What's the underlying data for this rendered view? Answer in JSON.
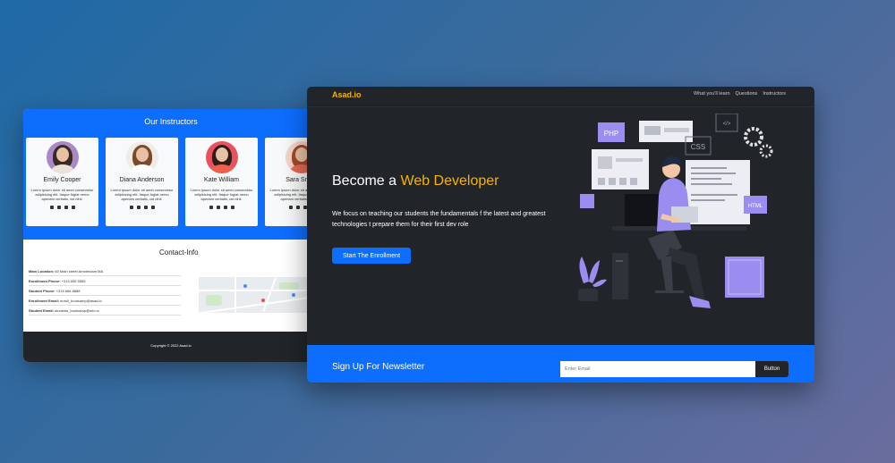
{
  "back_window": {
    "instructors": {
      "title": "Our Instructors",
      "people": [
        {
          "name": "Emily Cooper",
          "bio": "Lorem ipsum dolor sit amet consectetur adipisicing elit. Itaque fugiat nemo aperiam veritatis, cst nihil.",
          "bg": "#a98ac7",
          "hair": "#3b2a23",
          "shirt": "#e8e2d9"
        },
        {
          "name": "Diana Anderson",
          "bio": "Lorem ipsum dolor sit amet consectetur adipisicing elit. Itaque fugiat nemo aperiam veritatis, cst nihil.",
          "bg": "#f1ece6",
          "hair": "#7a4a2c",
          "shirt": "#ffffff"
        },
        {
          "name": "Kate William",
          "bio": "Lorem ipsum dolor sit amet consectetur adipisicing elit. Itaque fugiat nemo aperiam veritatis, cst nihil.",
          "bg": "#e9515f",
          "hair": "#2d1d1a",
          "shirt": "#ef5f4a"
        },
        {
          "name": "Sara Smith",
          "bio": "Lorem ipsum dolor sit amet consectetur adipisicing elit. Itaque fugiat nemo aperiam veritatis, cst nihil.",
          "bg": "#f3d7c9",
          "hair": "#a34a2b",
          "shirt": "#e86a55"
        }
      ],
      "social_icons": [
        "instagram-icon",
        "twitter-icon",
        "linkedin-icon",
        "facebook-icon"
      ]
    },
    "contact": {
      "title": "Contact-Info",
      "rows": [
        {
          "label": "Main Location:",
          "value": "60 Main street Amsterdam MA"
        },
        {
          "label": "Enrollment Phone:",
          "value": "+315 555 5555"
        },
        {
          "label": "Student Phone:",
          "value": "+315 666 8888"
        },
        {
          "label": "Enrollment Email:",
          "value": "enroll_bootcamp@asad.io"
        },
        {
          "label": "Student Email:",
          "value": "students_bootcamp@info.io"
        }
      ]
    },
    "footer": {
      "copyright": "Copyright © 2022 Asad.io"
    }
  },
  "front_window": {
    "brand": "Asad.io",
    "nav": [
      "What you'll learn",
      "Questions",
      "Instructors"
    ],
    "hero": {
      "title_prefix": "Become a",
      "title_accent": "Web Developer",
      "text": "We focus on teaching our students the fundamentals f the latest and greatest technologies t prepare them for their first dev role",
      "button": "Start The Enrollment",
      "illustration_labels": {
        "php": "PHP",
        "css": "CSS",
        "html": "HTML",
        "code": "</>"
      }
    },
    "newsletter": {
      "title": "Sign Up For Newsletter",
      "placeholder": "Enter Email",
      "button": "Button"
    }
  },
  "colors": {
    "primary": "#0d6efd",
    "accent": "#f5b400",
    "dark": "#212529",
    "illustration_purple": "#9b8cf0"
  }
}
